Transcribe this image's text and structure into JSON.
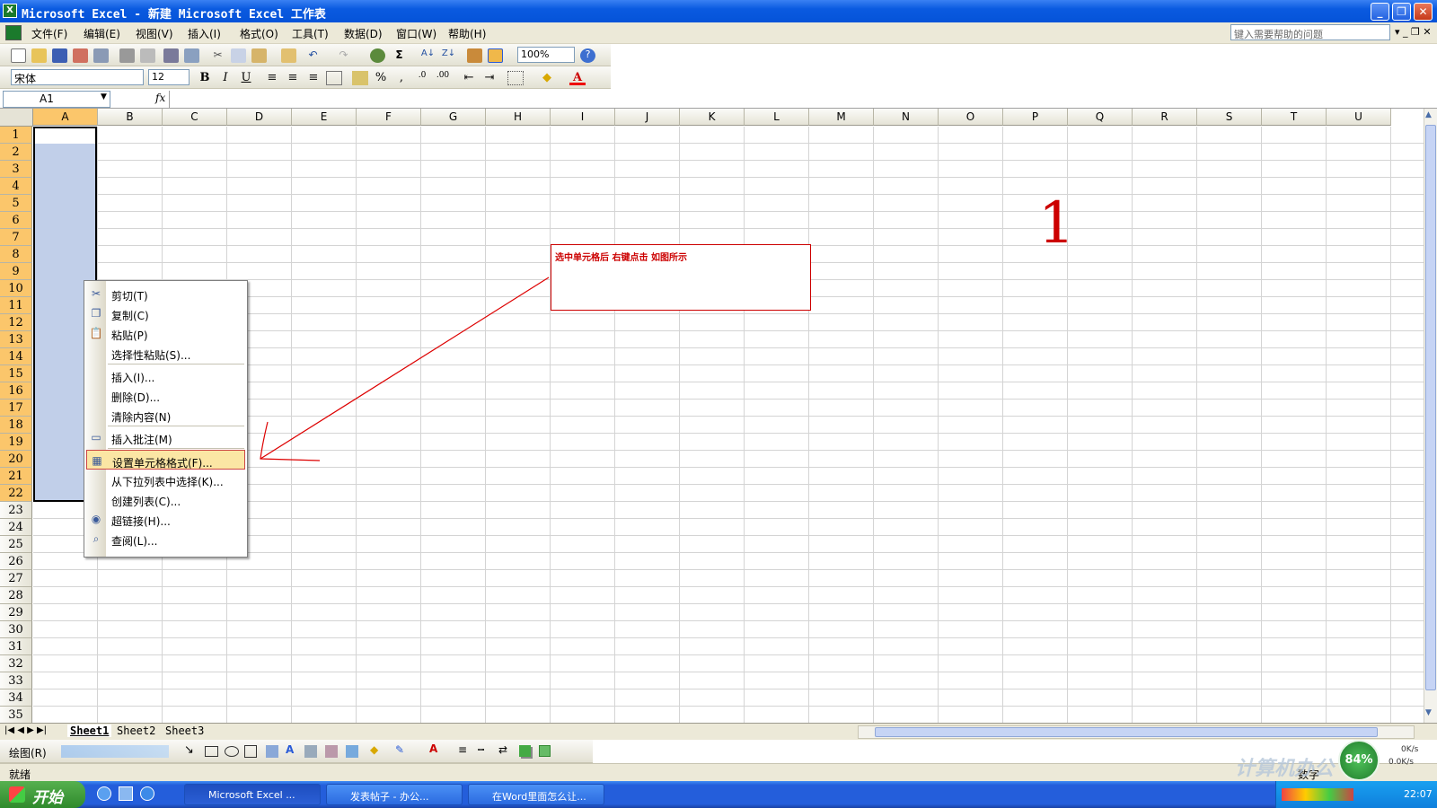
{
  "titlebar": {
    "title": "Microsoft Excel - 新建 Microsoft Excel 工作表",
    "icon": "excel-icon",
    "buttons": {
      "minimize": "_",
      "restore": "❐",
      "close": "✕"
    }
  },
  "menubar": {
    "items": [
      "文件(F)",
      "编辑(E)",
      "视图(V)",
      "插入(I)",
      "格式(O)",
      "工具(T)",
      "数据(D)",
      "窗口(W)",
      "帮助(H)"
    ],
    "help_placeholder": "键入需要帮助的问题"
  },
  "standard_toolbar": {
    "zoom": "100%"
  },
  "format_toolbar": {
    "font": "宋体",
    "size": "12",
    "bold": "B",
    "italic": "I",
    "underline": "U",
    "percent": "%",
    "comma": ","
  },
  "formula_bar": {
    "name_box": "A1",
    "fx": "fx",
    "value": ""
  },
  "grid": {
    "columns": [
      "A",
      "B",
      "C",
      "D",
      "E",
      "F",
      "G",
      "H",
      "I",
      "J",
      "K",
      "L",
      "M",
      "N",
      "O",
      "P",
      "Q",
      "R",
      "S",
      "T",
      "U"
    ],
    "rows": [
      "1",
      "2",
      "3",
      "4",
      "5",
      "6",
      "7",
      "8",
      "9",
      "10",
      "11",
      "12",
      "13",
      "14",
      "15",
      "16",
      "17",
      "18",
      "19",
      "20",
      "21",
      "22",
      "23",
      "24",
      "25",
      "26",
      "27",
      "28",
      "29",
      "30",
      "31",
      "32",
      "33",
      "34",
      "35"
    ],
    "selected_column": "A",
    "selected_rows": "1-22"
  },
  "context_menu": {
    "items": [
      {
        "label": "剪切(T)",
        "icon": "scissors-icon"
      },
      {
        "label": "复制(C)",
        "icon": "copy-icon"
      },
      {
        "label": "粘贴(P)",
        "icon": "paste-icon"
      },
      {
        "label": "选择性粘贴(S)...",
        "icon": ""
      },
      {
        "label": "插入(I)...",
        "icon": ""
      },
      {
        "label": "删除(D)...",
        "icon": ""
      },
      {
        "label": "清除内容(N)",
        "icon": ""
      },
      {
        "label": "插入批注(M)",
        "icon": "comment-icon"
      },
      {
        "label": "设置单元格格式(F)...",
        "icon": "format-cells-icon",
        "highlighted": true
      },
      {
        "label": "从下拉列表中选择(K)...",
        "icon": ""
      },
      {
        "label": "创建列表(C)...",
        "icon": ""
      },
      {
        "label": "超链接(H)...",
        "icon": "hyperlink-icon"
      },
      {
        "label": "查阅(L)...",
        "icon": "research-icon"
      }
    ]
  },
  "annotation": {
    "text": "选中单元格后 右键点击 如图所示",
    "number": "1",
    "color": "#cc0000"
  },
  "sheet_tabs": [
    "Sheet1",
    "Sheet2",
    "Sheet3"
  ],
  "drawing_toolbar": {
    "label": "绘图(R)"
  },
  "statusbar": {
    "left": "就绪",
    "right": "数字"
  },
  "taskbar": {
    "start": "开始",
    "tasks": [
      "Microsoft Excel ...",
      "发表帖子 - 办公...",
      "在Word里面怎么让..."
    ],
    "clock": "22:07",
    "net_up": "0K/s",
    "net_down": "0.0K/s",
    "badge": "84%",
    "watermark": "计算机办公"
  }
}
